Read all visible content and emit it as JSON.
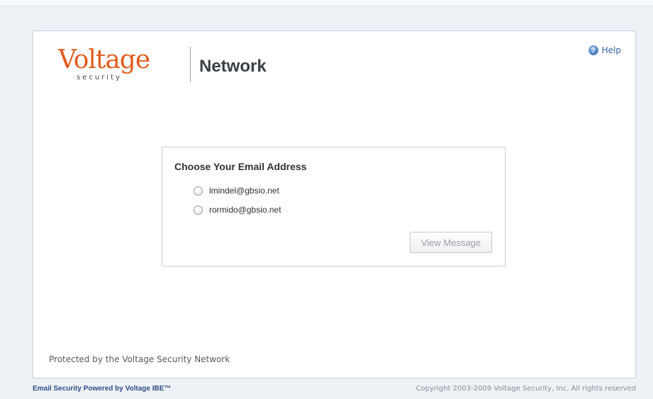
{
  "header": {
    "logo_word": "Voltage",
    "logo_sub": "security",
    "network_label": "Network",
    "help_label": "Help",
    "help_icon_glyph": "?"
  },
  "chooser": {
    "title": "Choose Your Email Address",
    "options": [
      {
        "label": "lmindel@gbsio.net",
        "selected": false
      },
      {
        "label": "rormido@gbsio.net",
        "selected": false
      }
    ],
    "view_button_label": "View Message",
    "view_button_enabled": false
  },
  "protected_text": "Protected by the Voltage Security Network",
  "footer": {
    "left": "Email Security Powered by Voltage IBE™",
    "right": "Copyright 2003-2009 Voltage Security, Inc. All rights reserved"
  },
  "colors": {
    "brand_orange": "#e05c1e",
    "link_blue": "#2f5f9e"
  }
}
